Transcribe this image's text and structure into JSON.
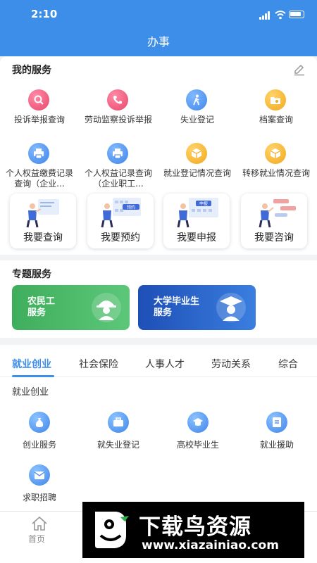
{
  "status": {
    "time": "2:10"
  },
  "nav": {
    "title": "办事"
  },
  "my_services": {
    "title": "我的服务",
    "items": [
      {
        "label": "投诉举报查询",
        "icon": "search-icon",
        "color": "pink"
      },
      {
        "label": "劳动监察投诉举报",
        "icon": "phone-icon",
        "color": "pink"
      },
      {
        "label": "失业登记",
        "icon": "walk-icon",
        "color": "blue"
      },
      {
        "label": "档案查询",
        "icon": "folder-icon",
        "color": "orange"
      },
      {
        "label": "个人权益缴费记录查询（企业...",
        "icon": "printer-icon",
        "color": "blue"
      },
      {
        "label": "个人权益记录查询（企业职工...",
        "icon": "printer-icon",
        "color": "blue"
      },
      {
        "label": "就业登记情况查询",
        "icon": "box-icon",
        "color": "orange"
      },
      {
        "label": "转移就业情况查询",
        "icon": "box-icon",
        "color": "orange"
      }
    ],
    "quick": [
      {
        "label": "我要查询",
        "tag": ""
      },
      {
        "label": "我要预约",
        "tag": "预约"
      },
      {
        "label": "我要申报",
        "tag": "申报"
      },
      {
        "label": "我要咨询",
        "tag": ""
      }
    ]
  },
  "special": {
    "title": "专题服务",
    "banners": [
      {
        "line1": "农民工",
        "line2": "服务",
        "color": "#4ab468"
      },
      {
        "line1": "大学毕业生",
        "line2": "服务",
        "color": "#2a62c9"
      }
    ]
  },
  "tabs": {
    "items": [
      "就业创业",
      "社会保险",
      "人事人才",
      "劳动关系",
      "综合"
    ],
    "active": 0,
    "subtitle": "就业创业",
    "categories": [
      {
        "label": "创业服务",
        "icon": "moneybag-icon"
      },
      {
        "label": "就失业登记",
        "icon": "briefcase-icon"
      },
      {
        "label": "高校毕业生",
        "icon": "graduation-cap-icon"
      },
      {
        "label": "就业援助",
        "icon": "document-icon"
      },
      {
        "label": "求职招聘",
        "icon": "mail-icon"
      }
    ]
  },
  "bottom_nav": {
    "home_label": "首页"
  },
  "watermark": {
    "title": "下载鸟资源",
    "url": "www.xiazainiao.com"
  },
  "colors": {
    "primary": "#3d8ee8",
    "pink": "#e8476b",
    "blue": "#3f86ea",
    "orange": "#f2a81c",
    "green": "#4ab468",
    "navy": "#2a62c9"
  }
}
